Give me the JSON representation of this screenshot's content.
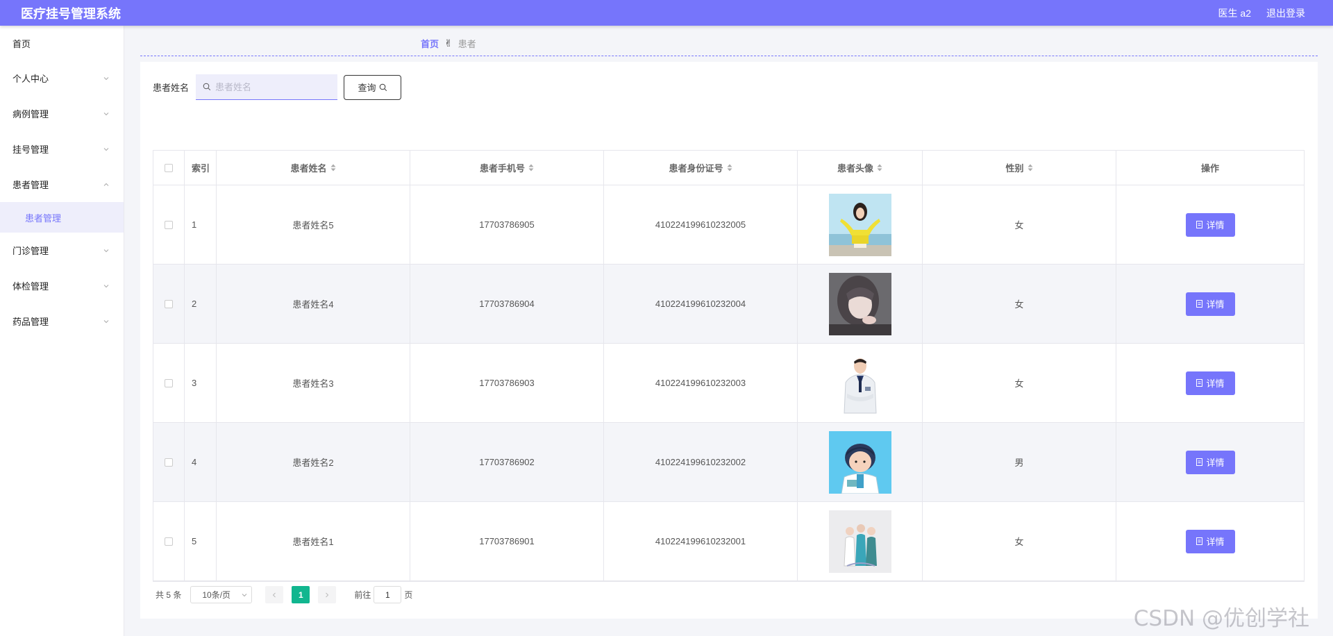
{
  "topbar": {
    "app_title": "医疗挂号管理系统",
    "user": "医生 a2",
    "logout_label": "退出登录",
    "bg_color": "#7675fb"
  },
  "sidebar": {
    "items": [
      {
        "label": "首页"
      },
      {
        "label": "个人中心"
      },
      {
        "label": "病例管理"
      },
      {
        "label": "挂号管理"
      },
      {
        "label": "患者管理",
        "expanded": true,
        "children": [
          {
            "label": "患者管理",
            "active": true
          }
        ]
      },
      {
        "label": "门诊管理"
      },
      {
        "label": "体检管理"
      },
      {
        "label": "药品管理"
      }
    ]
  },
  "breadcrumb": {
    "home": "首页",
    "separator_icon": "hand-icon",
    "current": "患者"
  },
  "search": {
    "label": "患者姓名",
    "placeholder": "患者姓名",
    "value": "",
    "button_label": "查询"
  },
  "table": {
    "columns": [
      "索引",
      "患者姓名",
      "患者手机号",
      "患者身份证号",
      "患者头像",
      "性别",
      "操作"
    ],
    "detail_label": "详情",
    "rows": [
      {
        "index": "1",
        "name": "患者姓名5",
        "phone": "17703786905",
        "id_card": "410224199610232005",
        "avatar": "girl-yellow-sweater",
        "sex": "女"
      },
      {
        "index": "2",
        "name": "患者姓名4",
        "phone": "17703786904",
        "id_card": "410224199610232004",
        "avatar": "girl-portrait",
        "sex": "女"
      },
      {
        "index": "3",
        "name": "患者姓名3",
        "phone": "17703786903",
        "id_card": "410224199610232003",
        "avatar": "male-doctor",
        "sex": "女"
      },
      {
        "index": "4",
        "name": "患者姓名2",
        "phone": "17703786902",
        "id_card": "410224199610232002",
        "avatar": "cartoon-doctor",
        "sex": "男"
      },
      {
        "index": "5",
        "name": "患者姓名1",
        "phone": "17703786901",
        "id_card": "410224199610232001",
        "avatar": "medical-staff-group",
        "sex": "女"
      }
    ]
  },
  "pagination": {
    "total_text": "共 5 条",
    "page_size": "10条/页",
    "current_page": "1",
    "goto_prefix": "前往",
    "goto_value": "1",
    "goto_suffix": "页",
    "active_color": "#11b68f"
  },
  "watermark": "CSDN @优创学社"
}
